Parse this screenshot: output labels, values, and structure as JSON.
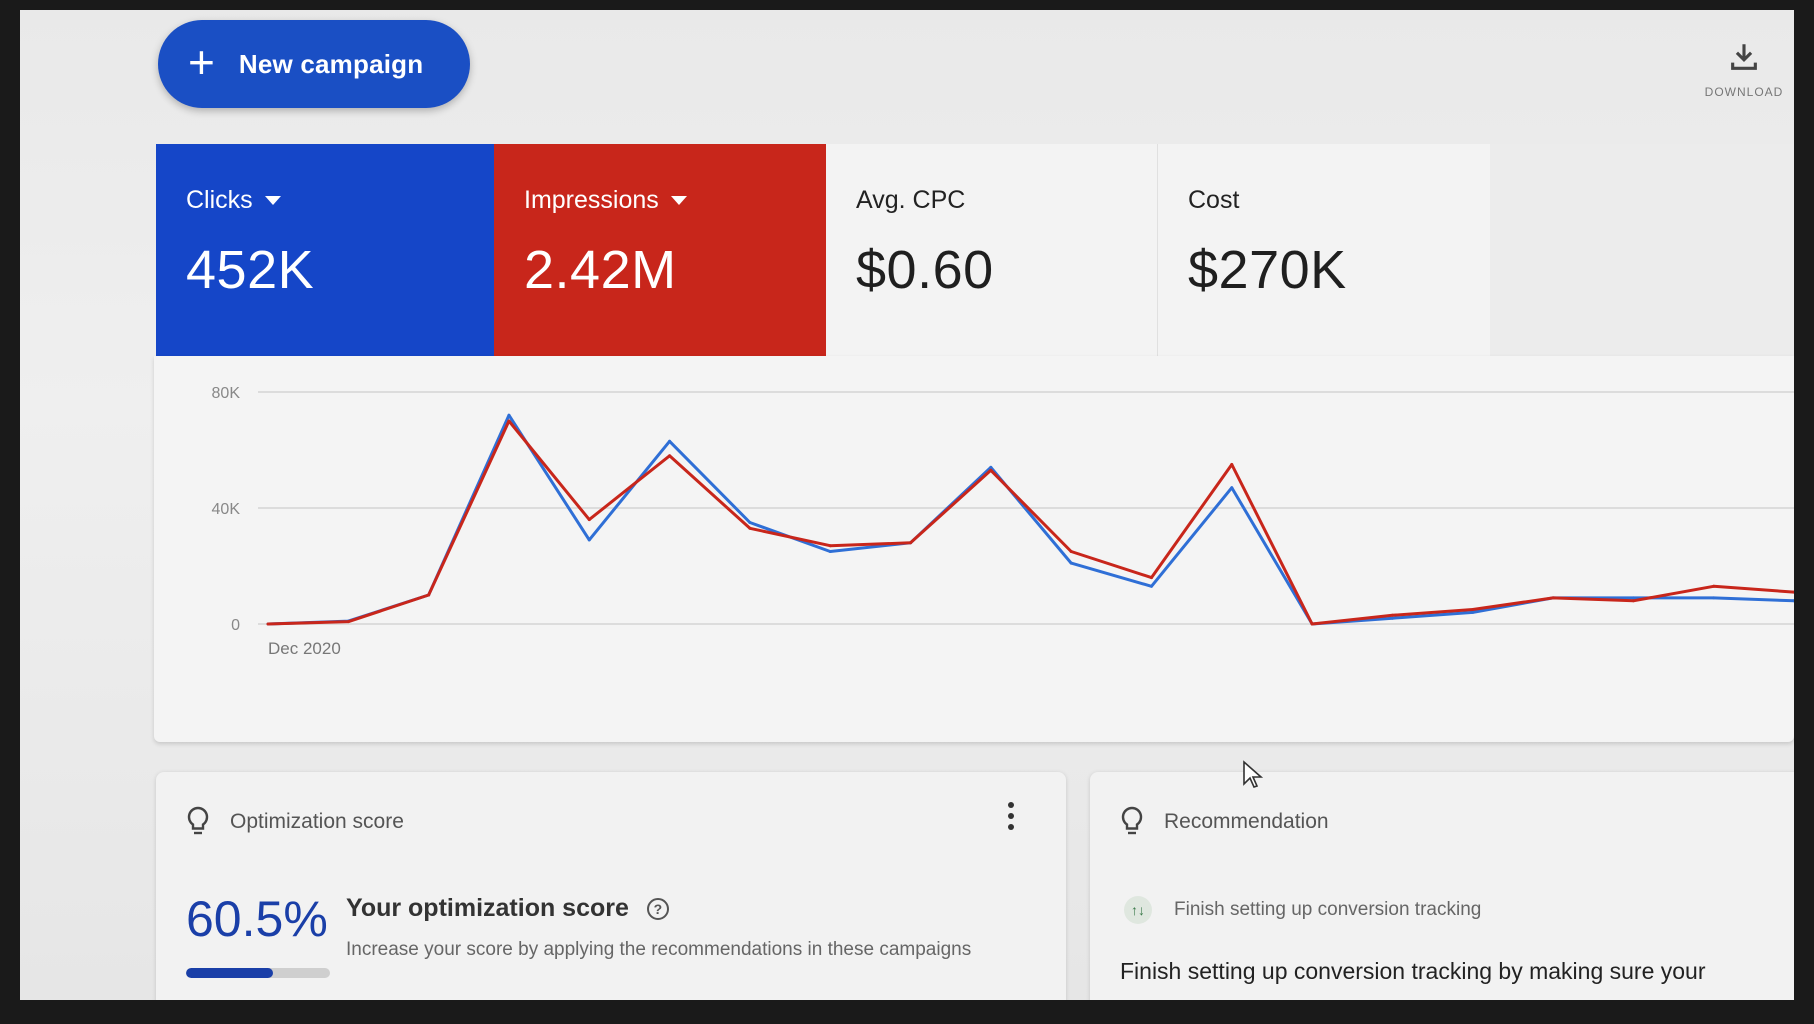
{
  "toolbar": {
    "new_campaign_label": "New campaign",
    "download_label": "DOWNLOAD"
  },
  "metrics": [
    {
      "label": "Clicks",
      "value": "452K",
      "color": "#1546c8",
      "selectable": true
    },
    {
      "label": "Impressions",
      "value": "2.42M",
      "color": "#c8261b",
      "selectable": true
    },
    {
      "label": "Avg. CPC",
      "value": "$0.60"
    },
    {
      "label": "Cost",
      "value": "$270K"
    }
  ],
  "chart_data": {
    "type": "line",
    "x_start_label": "Dec 2020",
    "yticks": [
      "80K",
      "40K",
      "0"
    ],
    "ylim": [
      0,
      80000
    ],
    "grid": true,
    "x": [
      0,
      1,
      2,
      3,
      4,
      5,
      6,
      7,
      8,
      9,
      10,
      11,
      12,
      13,
      14,
      15,
      16,
      17,
      18,
      19
    ],
    "series": [
      {
        "color": "#2f6fd6",
        "values": [
          0,
          1000,
          10000,
          72000,
          29000,
          63000,
          35000,
          25000,
          28000,
          54000,
          21000,
          13000,
          47000,
          0,
          2000,
          4000,
          9000,
          9000,
          9000,
          8000
        ]
      },
      {
        "color": "#c8261b",
        "values": [
          0,
          800,
          10000,
          70000,
          36000,
          58000,
          33000,
          27000,
          28000,
          53000,
          25000,
          16000,
          55000,
          0,
          3000,
          5000,
          9000,
          8000,
          13000,
          11000
        ]
      }
    ]
  },
  "optimization_card": {
    "title": "Optimization score",
    "score": "60.5%",
    "score_fraction": 0.605,
    "heading": "Your optimization score",
    "help_icon": "?",
    "description": "Increase your score by applying the recommendations in these campaigns"
  },
  "recommendation_card": {
    "title": "Recommendation",
    "item_icon": "↑↓",
    "item_label": "Finish setting up conversion tracking",
    "description": "Finish setting up conversion tracking by making sure your"
  }
}
